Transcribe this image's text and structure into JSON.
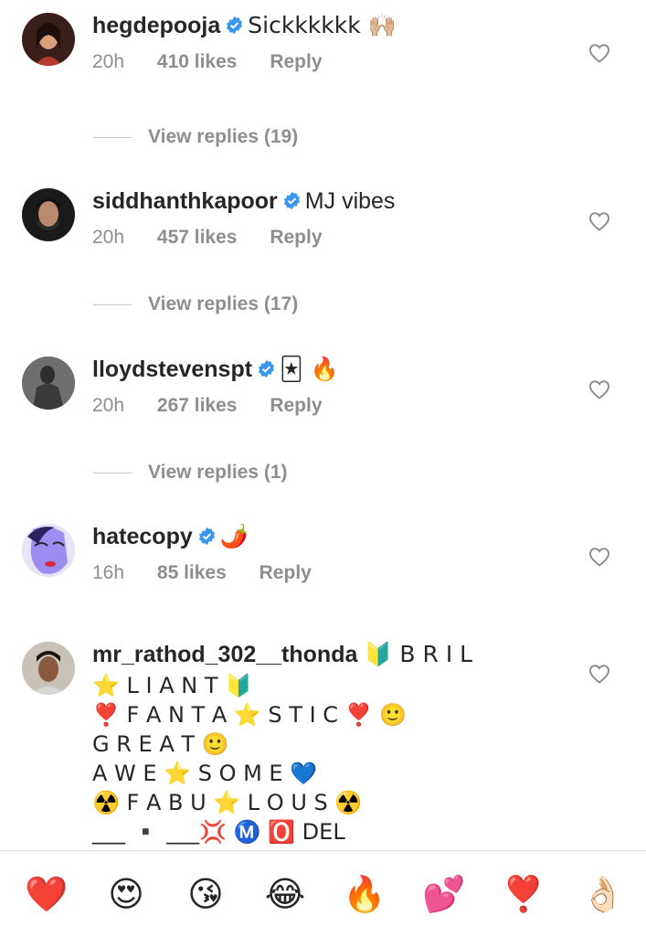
{
  "comments": [
    {
      "username": "hegdepooja",
      "verified": true,
      "text": "Sickkkkkk 🙌🏼",
      "time": "20h",
      "likes": "410 likes",
      "reply": "Reply",
      "view_replies": "View replies (19)",
      "avatar_color": "#6b2f2a"
    },
    {
      "username": "siddhanthkapoor",
      "verified": true,
      "text": "MJ vibes",
      "time": "20h",
      "likes": "457 likes",
      "reply": "Reply",
      "view_replies": "View replies (17)",
      "avatar_color": "#3c3c3c"
    },
    {
      "username": "lloydstevenspt",
      "verified": true,
      "text": "🃏 🔥",
      "time": "20h",
      "likes": "267 likes",
      "reply": "Reply",
      "view_replies": "View replies (1)",
      "avatar_color": "#5a5a5a"
    },
    {
      "username": "hatecopy",
      "verified": true,
      "text": "🌶️",
      "time": "16h",
      "likes": "85 likes",
      "reply": "Reply",
      "avatar_color": "#8c7be0"
    },
    {
      "username": "mr_rathod_302__thonda",
      "verified": false,
      "text_lines": [
        "🔰 B R I L",
        "⭐ L I A N T 🔰",
        "❣️ F A N T A ⭐ S T I C ❣️ 🙂",
        "G R E A T 🙂",
        "A W E ⭐ S O M E 💙",
        "☢️ F A B U ⭐ L O U S ☢️",
        "___ ▪️ ___💢 Ⓜ️ 🅾️ DEL"
      ],
      "avatar_color": "#8a6a55"
    }
  ],
  "reactions": [
    "❤️",
    "😍",
    "😘",
    "😂",
    "🔥",
    "💕",
    "❣️",
    "👌🏻"
  ],
  "colors": {
    "verified_blue": "#3897f0",
    "meta_grey": "#8e8e8e"
  }
}
